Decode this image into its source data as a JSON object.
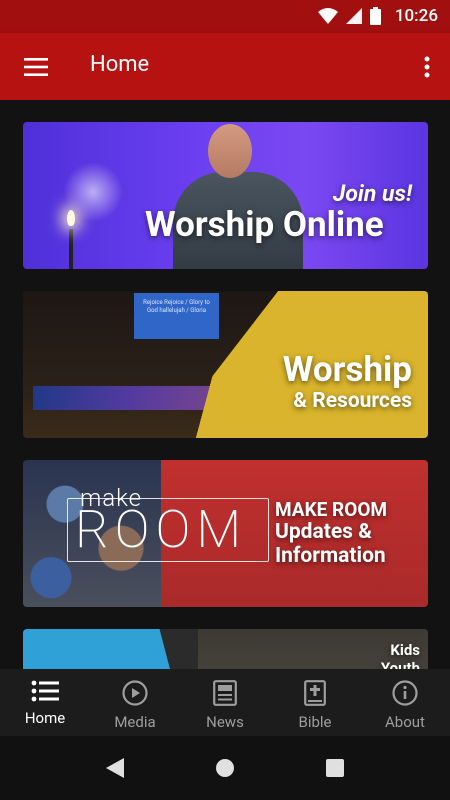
{
  "status_bar": {
    "time": "10:26"
  },
  "app_bar": {
    "title": "Home"
  },
  "banners": [
    {
      "tagline": "Join us!",
      "headline": "Worship Online"
    },
    {
      "headline": "Worship",
      "subline": "& Resources",
      "screen_text": "Rejoice Rejoice / Glory to God hallelujah / Gloria"
    },
    {
      "logo_top": "make",
      "logo_main": "ROOM",
      "line1": "MAKE ROOM",
      "line2": "Updates &",
      "line3": "Information"
    },
    {
      "line1": "Kids",
      "line2": "Youth"
    }
  ],
  "bottom_nav": [
    {
      "label": "Home",
      "icon": "list-icon",
      "active": true
    },
    {
      "label": "Media",
      "icon": "play-circle-icon",
      "active": false
    },
    {
      "label": "News",
      "icon": "newspaper-icon",
      "active": false
    },
    {
      "label": "Bible",
      "icon": "bible-icon",
      "active": false
    },
    {
      "label": "About",
      "icon": "info-icon",
      "active": false
    }
  ],
  "colors": {
    "app_bar": "#b71212",
    "status_bar": "#a10f0f",
    "nav_active": "#ffffff",
    "nav_inactive": "#9e9e9e"
  }
}
